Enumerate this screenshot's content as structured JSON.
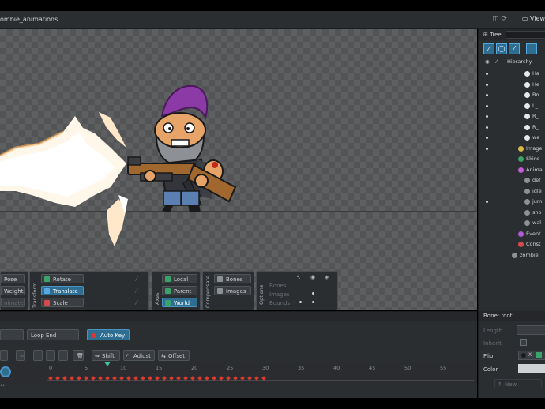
{
  "window": {
    "title": "ombie_animations",
    "views_label": "View"
  },
  "toolbar": {
    "pose_label": "Pose",
    "weights_label": "Weights",
    "animate_label": "nimate",
    "transform_group": "Transform",
    "axes_group": "Axes",
    "compensate_group": "Compensate",
    "options_group": "Options",
    "rotate_label": "Rotate",
    "translate_label": "Translate",
    "scale_label": "Scale",
    "local_label": "Local",
    "parent_label": "Parent",
    "world_label": "World",
    "bones_label": "Bones",
    "images_label": "Images",
    "options_rows": [
      "Bones",
      "Images",
      "Bounds"
    ]
  },
  "timeline": {
    "loop_start_label": "",
    "loop_end_label": "Loop End",
    "auto_key_label": "Auto Key",
    "shift_label": "Shift",
    "adjust_label": "Adjust",
    "offset_label": "Offset",
    "ticks": [
      "0",
      "5",
      "10",
      "15",
      "20",
      "25",
      "30",
      "35",
      "40",
      "45",
      "50",
      "55"
    ],
    "current_frame": 8,
    "key_frames_end": 30
  },
  "tree": {
    "tab_label": "Tree",
    "hierarchy_label": "Hierarchy",
    "rows": [
      {
        "label": "Ha",
        "type": "bone"
      },
      {
        "label": "He",
        "type": "bone"
      },
      {
        "label": "Bo",
        "type": "bone"
      },
      {
        "label": "L_",
        "type": "bone"
      },
      {
        "label": "R_",
        "type": "bone"
      },
      {
        "label": "R_",
        "type": "bone"
      },
      {
        "label": "we",
        "type": "bone"
      },
      {
        "label": "Image",
        "type": "images"
      },
      {
        "label": "Skins",
        "type": "skins"
      },
      {
        "label": "Anima",
        "type": "anim"
      },
      {
        "label": "def",
        "type": "animitem"
      },
      {
        "label": "idle",
        "type": "animitem"
      },
      {
        "label": "jum",
        "type": "animitem"
      },
      {
        "label": "sho",
        "type": "animitem"
      },
      {
        "label": "wal",
        "type": "animitem"
      },
      {
        "label": "Event",
        "type": "event"
      },
      {
        "label": "Const",
        "type": "const"
      },
      {
        "label": "zombie",
        "type": "skel"
      }
    ]
  },
  "bone_props": {
    "header": "Bone: root",
    "length_label": "Length",
    "inherit_label": "Inherit",
    "flip_label": "Flip",
    "color_label": "Color",
    "new_label": "New",
    "x_label": "X"
  },
  "colors": {
    "accent": "#2f6e93",
    "key": "#d9392f",
    "playhead": "#3ec6a8"
  }
}
